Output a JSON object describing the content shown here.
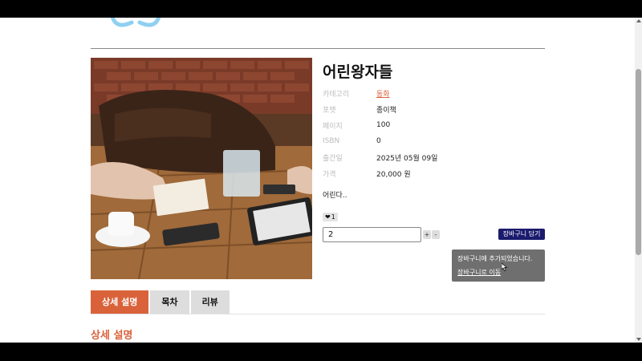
{
  "product": {
    "title": "어린왕자들",
    "fields": [
      {
        "label": "카테고리",
        "value": "동화"
      },
      {
        "label": "포맷",
        "value": "종이책"
      },
      {
        "label": "페이지",
        "value": "100"
      },
      {
        "label": "ISBN",
        "value": "0"
      },
      {
        "label": "출간일",
        "value": "2025년 05월 09일"
      },
      {
        "label": "가격",
        "value": "20,000 원"
      }
    ],
    "description": "어린다..",
    "like_count": "1"
  },
  "cart": {
    "quantity": "2",
    "plus_label": "+",
    "minus_label": "-",
    "add_label": "장바구니 담기",
    "toast_message": "장바구니에 추가되었습니다.",
    "toast_link": "장바구니로 이동"
  },
  "tabs": [
    {
      "label": "상세 설명"
    },
    {
      "label": "목차"
    },
    {
      "label": "리뷰"
    }
  ],
  "section": {
    "title": "상세 설명"
  },
  "colors": {
    "accent": "#d9623a",
    "cart_button": "#1b1b6e",
    "toast": "#6f6f6f",
    "logo": "#8fd0f0"
  }
}
